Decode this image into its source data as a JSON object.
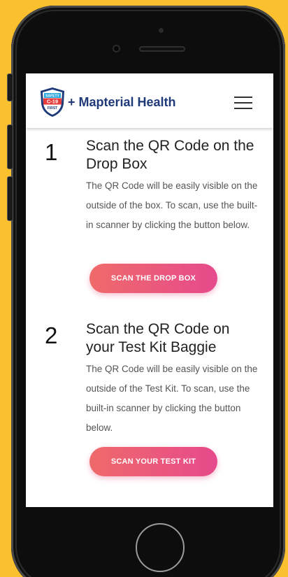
{
  "header": {
    "brand": "+ Mapterial Health",
    "logo_text_top": "SAFETY",
    "logo_text_mid": "C-19",
    "logo_text_bottom": "FIRST"
  },
  "steps": [
    {
      "number": "1",
      "title": "Scan the QR Code on the Drop Box",
      "text": "The QR Code will be easily visible on the outside of the box. To scan, use the built-in scanner by clicking the button below.",
      "button": "SCAN THE DROP BOX"
    },
    {
      "number": "2",
      "title": "Scan the QR Code on your Test Kit Baggie",
      "text": "The QR Code will be easily visible on the outside of the Test Kit. To scan, use the built-in scanner by clicking the button below.",
      "button": "SCAN YOUR TEST KIT"
    }
  ],
  "colors": {
    "background": "#fbc02d",
    "brand": "#1f3a78",
    "button_start": "#ef6a6a",
    "button_end": "#e64a8c"
  }
}
